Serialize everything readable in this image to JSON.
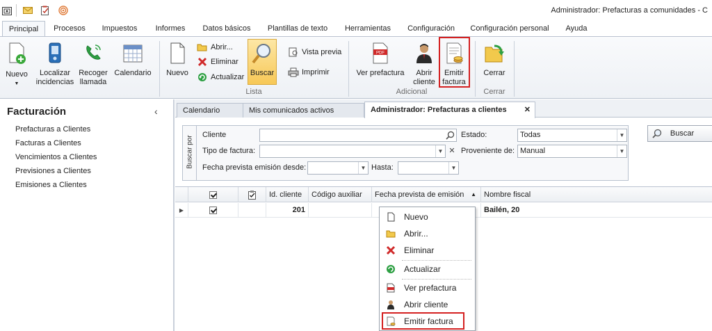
{
  "window": {
    "title": "Administrador: Prefacturas a comunidades - C"
  },
  "quick_access": {
    "icons": [
      "app-icon",
      "mail-icon",
      "tasks-icon",
      "broadcast-icon"
    ]
  },
  "ribbon_tabs": [
    "Principal",
    "Procesos",
    "Impuestos",
    "Informes",
    "Datos básicos",
    "Plantillas de texto",
    "Herramientas",
    "Configuración",
    "Configuración personal",
    "Ayuda"
  ],
  "active_tab": "Principal",
  "ribbon": {
    "nuevo_menu": "Nuevo",
    "localizar": "Localizar\nincidencias",
    "recoger": "Recoger\nllamada",
    "calendario": "Calendario",
    "nuevo": "Nuevo",
    "abrir": "Abrir...",
    "eliminar": "Eliminar",
    "actualizar": "Actualizar",
    "buscar": "Buscar",
    "vista_previa": "Vista previa",
    "imprimir": "Imprimir",
    "group_lista": "Lista",
    "ver_prefactura": "Ver prefactura",
    "abrir_cliente": "Abrir\ncliente",
    "emitir_factura": "Emitir\nfactura",
    "group_adicional": "Adicional",
    "cerrar": "Cerrar",
    "group_cerrar": "Cerrar"
  },
  "nav": {
    "title": "Facturación",
    "collapse": "‹",
    "items": [
      "Prefacturas a Clientes",
      "Facturas a Clientes",
      "Vencimientos a Clientes",
      "Previsiones a Clientes",
      "Emisiones a Clientes"
    ]
  },
  "doc_tabs": [
    "Calendario",
    "Mis comunicados activos",
    "Administrador: Prefacturas a clientes"
  ],
  "doc_tab_close": "✕",
  "search": {
    "vertical_label": "Buscar por",
    "cliente_label": "Cliente",
    "cliente_value": "",
    "tipo_label": "Tipo de factura:",
    "tipo_value": "",
    "fecha_desde_label": "Fecha prevista emisión desde:",
    "hasta_label": "Hasta:",
    "estado_label": "Estado:",
    "estado_value": "Todas",
    "proveniente_label": "Proveniente de:",
    "proveniente_value": "Manual",
    "buscar_button": "Buscar"
  },
  "grid": {
    "columns": [
      "",
      "",
      "Id. cliente",
      "Código auxiliar",
      "Fecha prevista de emisión",
      "Nombre fiscal"
    ],
    "rows": [
      {
        "id": "201",
        "codigo": "",
        "fecha": "",
        "nombre": "Bailén, 20"
      }
    ]
  },
  "context_menu": [
    "Nuevo",
    "Abrir...",
    "Eliminar",
    "Actualizar",
    "Ver prefactura",
    "Abrir cliente",
    "Emitir factura"
  ],
  "colors": {
    "highlight": "#d42020",
    "accent": "#2b6cb0",
    "ribbon_bg": "#eef1f5"
  }
}
